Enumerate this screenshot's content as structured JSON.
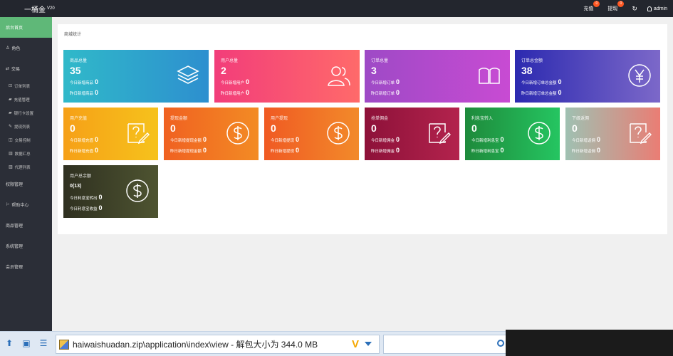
{
  "header": {
    "brand": "一桶金",
    "version": "V20",
    "recharge_label": "充值",
    "recharge_badge": "0",
    "withdraw_label": "提现",
    "withdraw_badge": "0",
    "refresh_icon": "refresh-icon",
    "user_label": "admin"
  },
  "sidebar": {
    "items": [
      {
        "label": "后台首页",
        "active": true
      },
      {
        "label": "角色",
        "icon": "user-icon"
      },
      {
        "label": "交易",
        "icon": "exchange-icon"
      },
      {
        "label": "订单列表",
        "sub": true
      },
      {
        "label": "充值管理",
        "sub": true
      },
      {
        "label": "银行卡设置",
        "sub": true
      },
      {
        "label": "提现列表",
        "sub": true
      },
      {
        "label": "交易控制",
        "sub": true
      },
      {
        "label": "数据汇总",
        "sub": true
      },
      {
        "label": "代理列表",
        "sub": true
      },
      {
        "label": "权限管理"
      },
      {
        "label": "帮助中心"
      },
      {
        "label": "商品管理"
      },
      {
        "label": "系统管理"
      },
      {
        "label": "会员管理"
      }
    ]
  },
  "main": {
    "panel_title": "商城统计",
    "cards": [
      {
        "title": "商品总量",
        "value": "35",
        "sub1": "今日新增商品",
        "sub1_val": "0",
        "sub2": "昨日新增商品",
        "sub2_val": "0",
        "icon": "layers-icon",
        "colors": [
          "#30b9c9",
          "#2d8fcf"
        ]
      },
      {
        "title": "用户总量",
        "value": "2",
        "sub1": "今日新增用户",
        "sub1_val": "0",
        "sub2": "昨日新增用户",
        "sub2_val": "0",
        "icon": "users-icon",
        "colors": [
          "#f23d7a",
          "#ff6a6a"
        ]
      },
      {
        "title": "订单总量",
        "value": "3",
        "sub1": "今日新增订单",
        "sub1_val": "0",
        "sub2": "昨日新增订单",
        "sub2_val": "0",
        "icon": "book-icon",
        "colors": [
          "#9e4ac6",
          "#c84bd3"
        ]
      },
      {
        "title": "订单总金额",
        "value": "38",
        "sub1": "今日新增订单总金额",
        "sub1_val": "0",
        "sub2": "昨日新增订单总金额",
        "sub2_val": "0",
        "icon": "yen-icon",
        "colors": [
          "#2c2ab0",
          "#7c68c9"
        ]
      },
      {
        "title": "用户充值",
        "value": "0",
        "sub1": "今日新增充值",
        "sub1_val": "0",
        "sub2": "昨日新增充值",
        "sub2_val": "0",
        "icon": "edit-question-icon",
        "colors": [
          "#f6a017",
          "#f6c21c"
        ]
      },
      {
        "title": "提现金额",
        "value": "0",
        "sub1": "今日新增提现金额",
        "sub1_val": "0",
        "sub2": "昨日新增提现金额",
        "sub2_val": "0",
        "icon": "dollar-icon",
        "colors": [
          "#f06121",
          "#f38b24"
        ]
      },
      {
        "title": "用户提现",
        "value": "0",
        "sub1": "今日新增提现",
        "sub1_val": "0",
        "sub2": "昨日新增提现",
        "sub2_val": "0",
        "icon": "dollar-icon",
        "colors": [
          "#f05a23",
          "#f28a2a"
        ]
      },
      {
        "title": "抢单佣金",
        "value": "0",
        "sub1": "今日新增佣金",
        "sub1_val": "0",
        "sub2": "昨日新增佣金",
        "sub2_val": "0",
        "icon": "edit-question-icon",
        "colors": [
          "#8d1139",
          "#b3234d"
        ]
      },
      {
        "title": "利息宝转入",
        "value": "0",
        "sub1": "今日新增利息宝",
        "sub1_val": "0",
        "sub2": "昨日新增利息宝",
        "sub2_val": "0",
        "icon": "dollar-icon",
        "colors": [
          "#1e8a3b",
          "#25c561"
        ]
      },
      {
        "title": "下级返佣",
        "value": "0",
        "sub1": "今日新增返佣",
        "sub1_val": "0",
        "sub2": "昨日新增返佣",
        "sub2_val": "0",
        "icon": "edit-question-icon",
        "colors": [
          "#9fc1b2",
          "#ea7d74"
        ]
      },
      {
        "title": "用户总余额",
        "value": "0(13)",
        "sub1": "今日利息宝转出",
        "sub1_val": "0",
        "sub2": "今日利息宝收益",
        "sub2_val": "0",
        "icon": "dollar-icon",
        "colors": [
          "#2f3020",
          "#4e5431"
        ],
        "small": true
      }
    ]
  },
  "bottombar": {
    "address": "haiwaishuadan.zip\\application\\index\\view - 解包大小为 344.0 MB",
    "address_badge": "V"
  }
}
